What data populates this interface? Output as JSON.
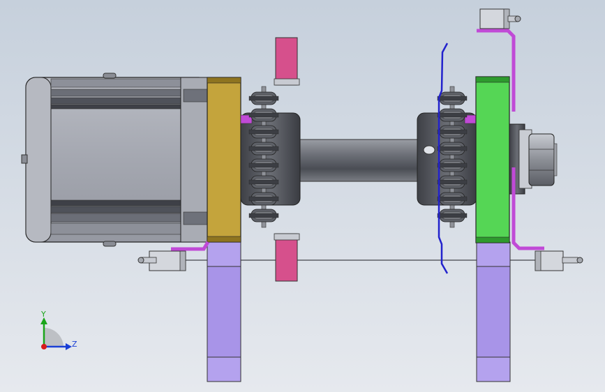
{
  "triad": {
    "y_label": "Y",
    "z_label": "Z",
    "y_color": "#1aa51a",
    "z_color": "#1a3fd6",
    "x_color": "#d61a1a"
  },
  "colors": {
    "background_top": "#c9d3df",
    "background_bottom": "#e4e8ee",
    "motor_body": "#a7aab3",
    "motor_dark": "#4f525a",
    "gearbox": "#c4a43c",
    "green_plate": "#55d655",
    "purple_block": "#a894e8",
    "pink_block": "#d6508c",
    "magenta_bracket": "#c04ad6",
    "shaft": "#6d7078",
    "sprocket": "#5e6168",
    "blue_guide": "#2222cc"
  }
}
